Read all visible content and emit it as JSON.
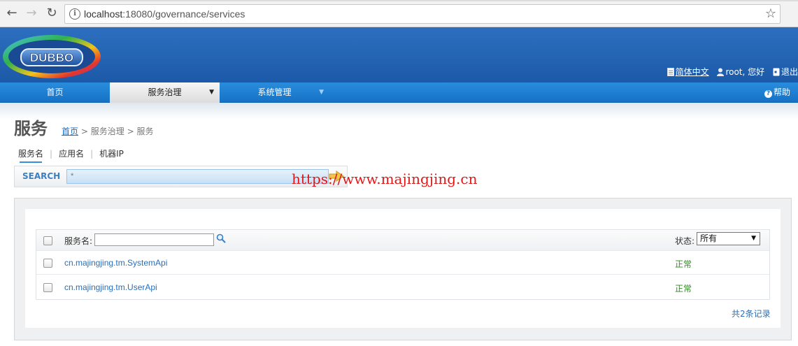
{
  "browser": {
    "url_host": "localhost",
    "url_rest": ":18080/governance/services"
  },
  "header": {
    "logo_text": "DUBBO",
    "lang_link": "简体中文",
    "user_text": "root, 您好",
    "logout_text": "退出"
  },
  "menu": {
    "items": [
      {
        "label": "首页"
      },
      {
        "label": "服务治理"
      },
      {
        "label": "系统管理"
      }
    ],
    "help_label": "帮助"
  },
  "page": {
    "title": "服务",
    "breadcrumb": {
      "home": "首页",
      "sep1": ">",
      "mid": "服务治理",
      "sep2": ">",
      "current": "服务"
    },
    "subtabs": [
      "服务名",
      "应用名",
      "机器IP"
    ],
    "search": {
      "label": "SEARCH",
      "value": "*"
    },
    "watermark": "https://www.majingjing.cn"
  },
  "table": {
    "filter_label": "服务名:",
    "status_label": "状态:",
    "status_selected": "所有",
    "rows": [
      {
        "service": "cn.majingjing.tm.SystemApi",
        "status": "正常"
      },
      {
        "service": "cn.majingjing.tm.UserApi",
        "status": "正常"
      }
    ],
    "total": "共2条记录"
  },
  "colors": {
    "header_blue": "#1c5aa8",
    "menu_blue": "#1572c6",
    "link_blue": "#2a6fb8",
    "status_green": "#2e8b1e",
    "watermark_red": "#e01818"
  },
  "icons": [
    "back-arrow-icon",
    "forward-arrow-icon",
    "reload-icon",
    "info-icon",
    "star-icon",
    "document-icon",
    "user-icon",
    "logout-icon",
    "help-icon",
    "search-go-arrow-icon",
    "magnifier-icon"
  ]
}
